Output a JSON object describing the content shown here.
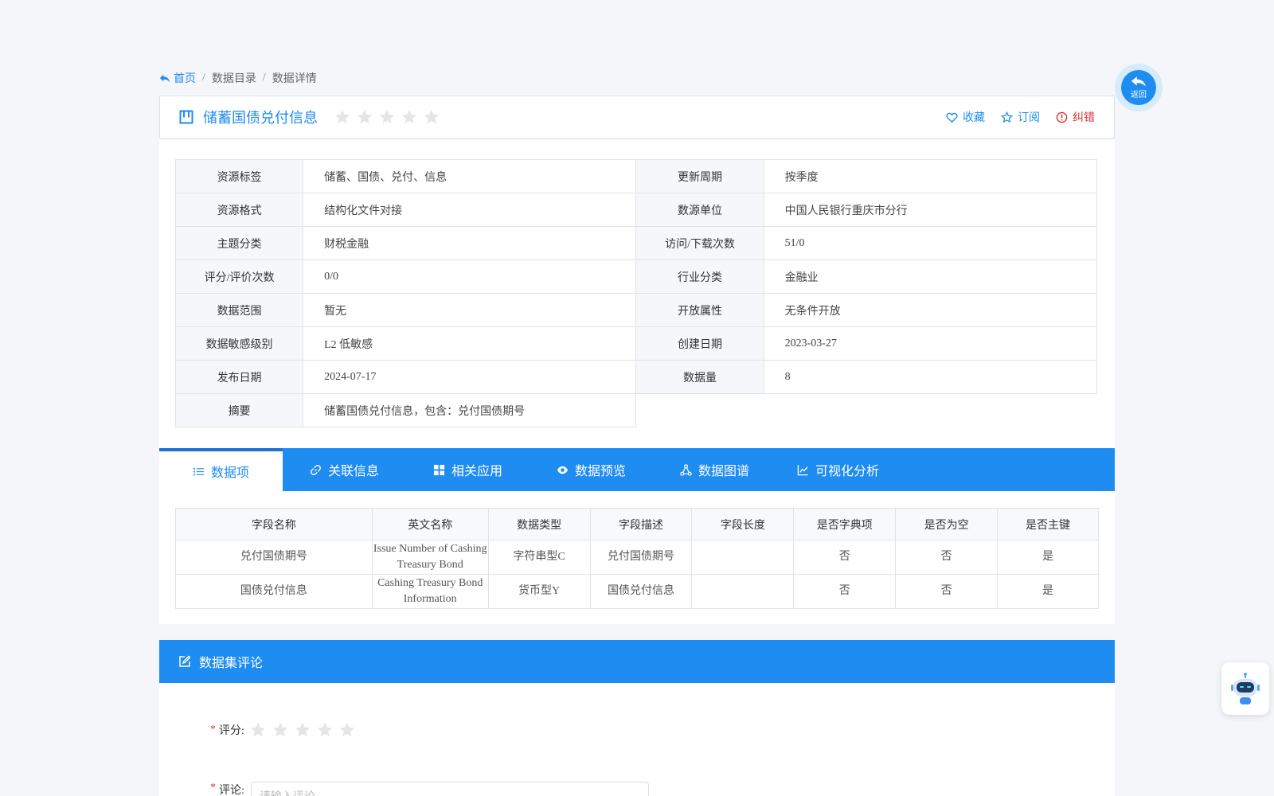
{
  "breadcrumb": {
    "home": "首页",
    "sep": "/",
    "items": [
      "数据目录",
      "数据详情"
    ]
  },
  "header": {
    "title": "储蓄国债兑付信息",
    "rating": 0,
    "actions": {
      "favorite": "收藏",
      "subscribe": "订阅",
      "report": "纠错"
    }
  },
  "back_button": {
    "label": "返回"
  },
  "info": [
    {
      "l1": "资源标签",
      "v1": "储蓄、国债、兑付、信息",
      "l2": "更新周期",
      "v2": "按季度"
    },
    {
      "l1": "资源格式",
      "v1": "结构化文件对接",
      "l2": "数源单位",
      "v2": "中国人民银行重庆市分行"
    },
    {
      "l1": "主题分类",
      "v1": "财税金融",
      "l2": "访问/下载次数",
      "v2": "51/0"
    },
    {
      "l1": "评分/评价次数",
      "v1": "0/0",
      "l2": "行业分类",
      "v2": "金融业"
    },
    {
      "l1": "数据范围",
      "v1": "暂无",
      "l2": "开放属性",
      "v2": "无条件开放"
    },
    {
      "l1": "数据敏感级别",
      "v1": "L2 低敏感",
      "l2": "创建日期",
      "v2": "2023-03-27"
    },
    {
      "l1": "发布日期",
      "v1": "2024-07-17",
      "l2": "数据量",
      "v2": "8"
    },
    {
      "l1": "摘要",
      "v1": "储蓄国债兑付信息，包含：兑付国债期号"
    }
  ],
  "tabs": [
    "数据项",
    "关联信息",
    "相关应用",
    "数据预览",
    "数据图谱",
    "可视化分析"
  ],
  "fields": {
    "columns": [
      "字段名称",
      "英文名称",
      "数据类型",
      "字段描述",
      "字段长度",
      "是否字典项",
      "是否为空",
      "是否主键"
    ],
    "rows": [
      [
        "兑付国债期号",
        "Issue Number of Cashing Treasury Bond",
        "字符串型C",
        "兑付国债期号",
        "",
        "否",
        "否",
        "是"
      ],
      [
        "国债兑付信息",
        "Cashing Treasury Bond Information",
        "货币型Y",
        "国债兑付信息",
        "",
        "否",
        "否",
        "是"
      ]
    ]
  },
  "comments": {
    "title": "数据集评论",
    "rating_label": "评分:",
    "required_mark": "*",
    "comment_label": "评论:",
    "comment_placeholder": "请输入评论"
  },
  "colors": {
    "primary": "#1e8cf0",
    "danger": "#e0303a"
  }
}
